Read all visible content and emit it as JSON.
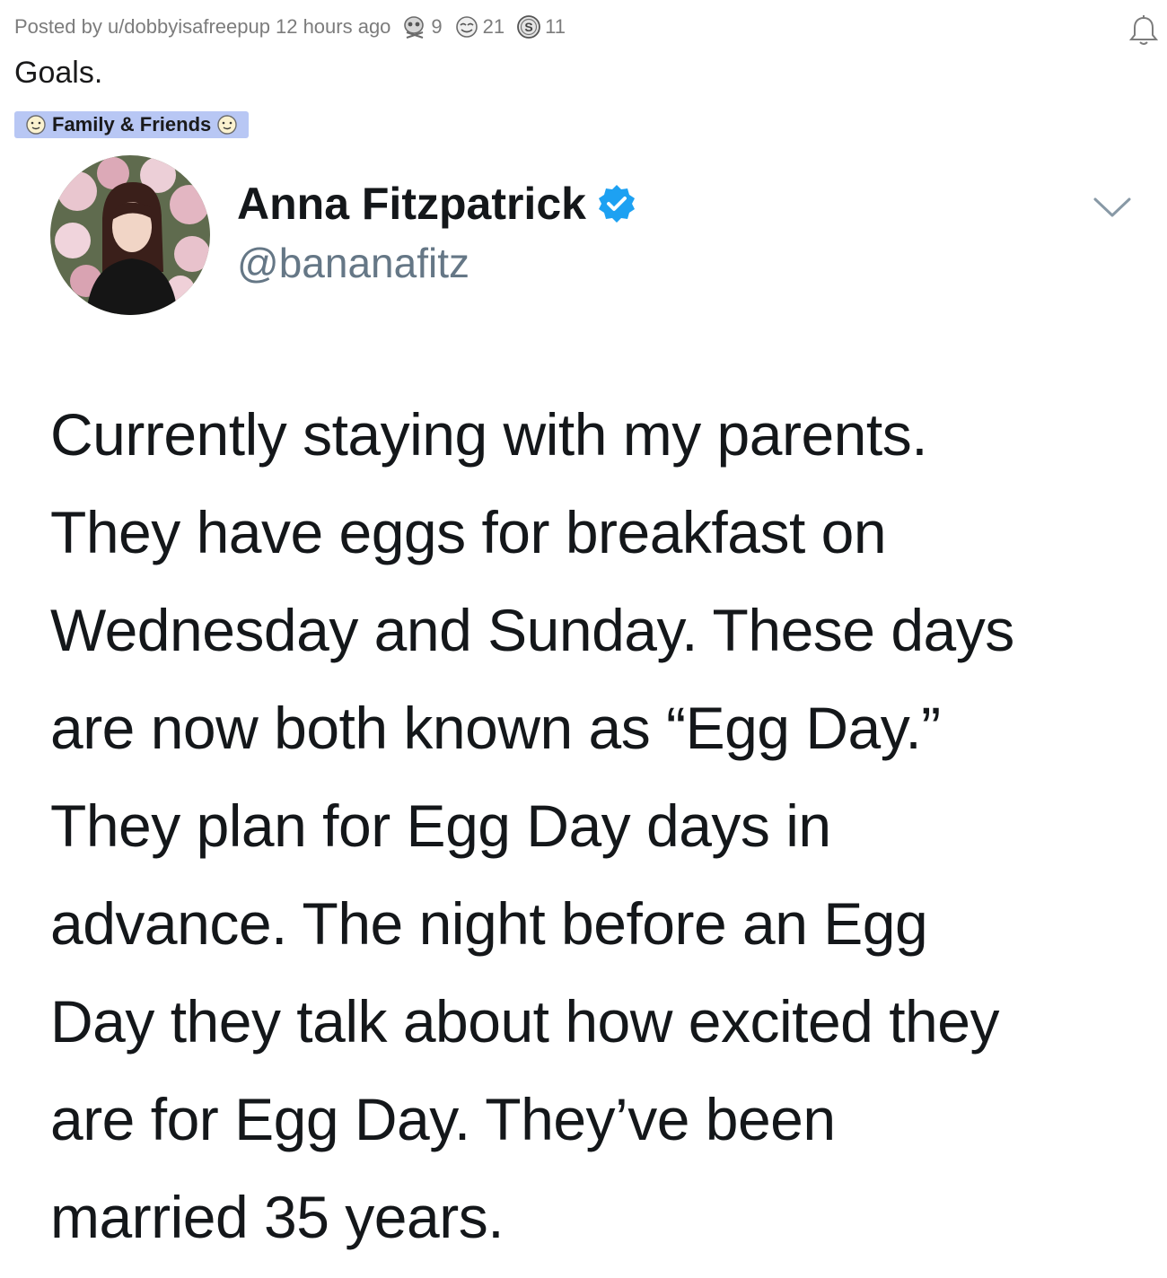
{
  "post": {
    "posted_by": "Posted by u/dobbyisafreepup",
    "time_ago": "12 hours ago",
    "awards": [
      {
        "icon": "skull-award-icon",
        "count": "9"
      },
      {
        "icon": "face-award-icon",
        "count": "21"
      },
      {
        "icon": "silver-coin-icon",
        "count": "11"
      }
    ],
    "title": "Goals.",
    "flair": "Family & Friends",
    "notification_icon": "bell-icon"
  },
  "tweet": {
    "display_name": "Anna Fitzpatrick",
    "handle": "@bananafitz",
    "verified_color": "#1da1f2",
    "lines": [
      "Currently staying with my parents.",
      "They have eggs for breakfast on",
      "Wednesday and Sunday. These days",
      "are now both known as “Egg Day.”",
      "They plan for Egg Day days in",
      "advance. The night before an Egg",
      "Day they talk about how excited they",
      "are for Egg Day. They’ve been",
      "married 35 years."
    ]
  }
}
